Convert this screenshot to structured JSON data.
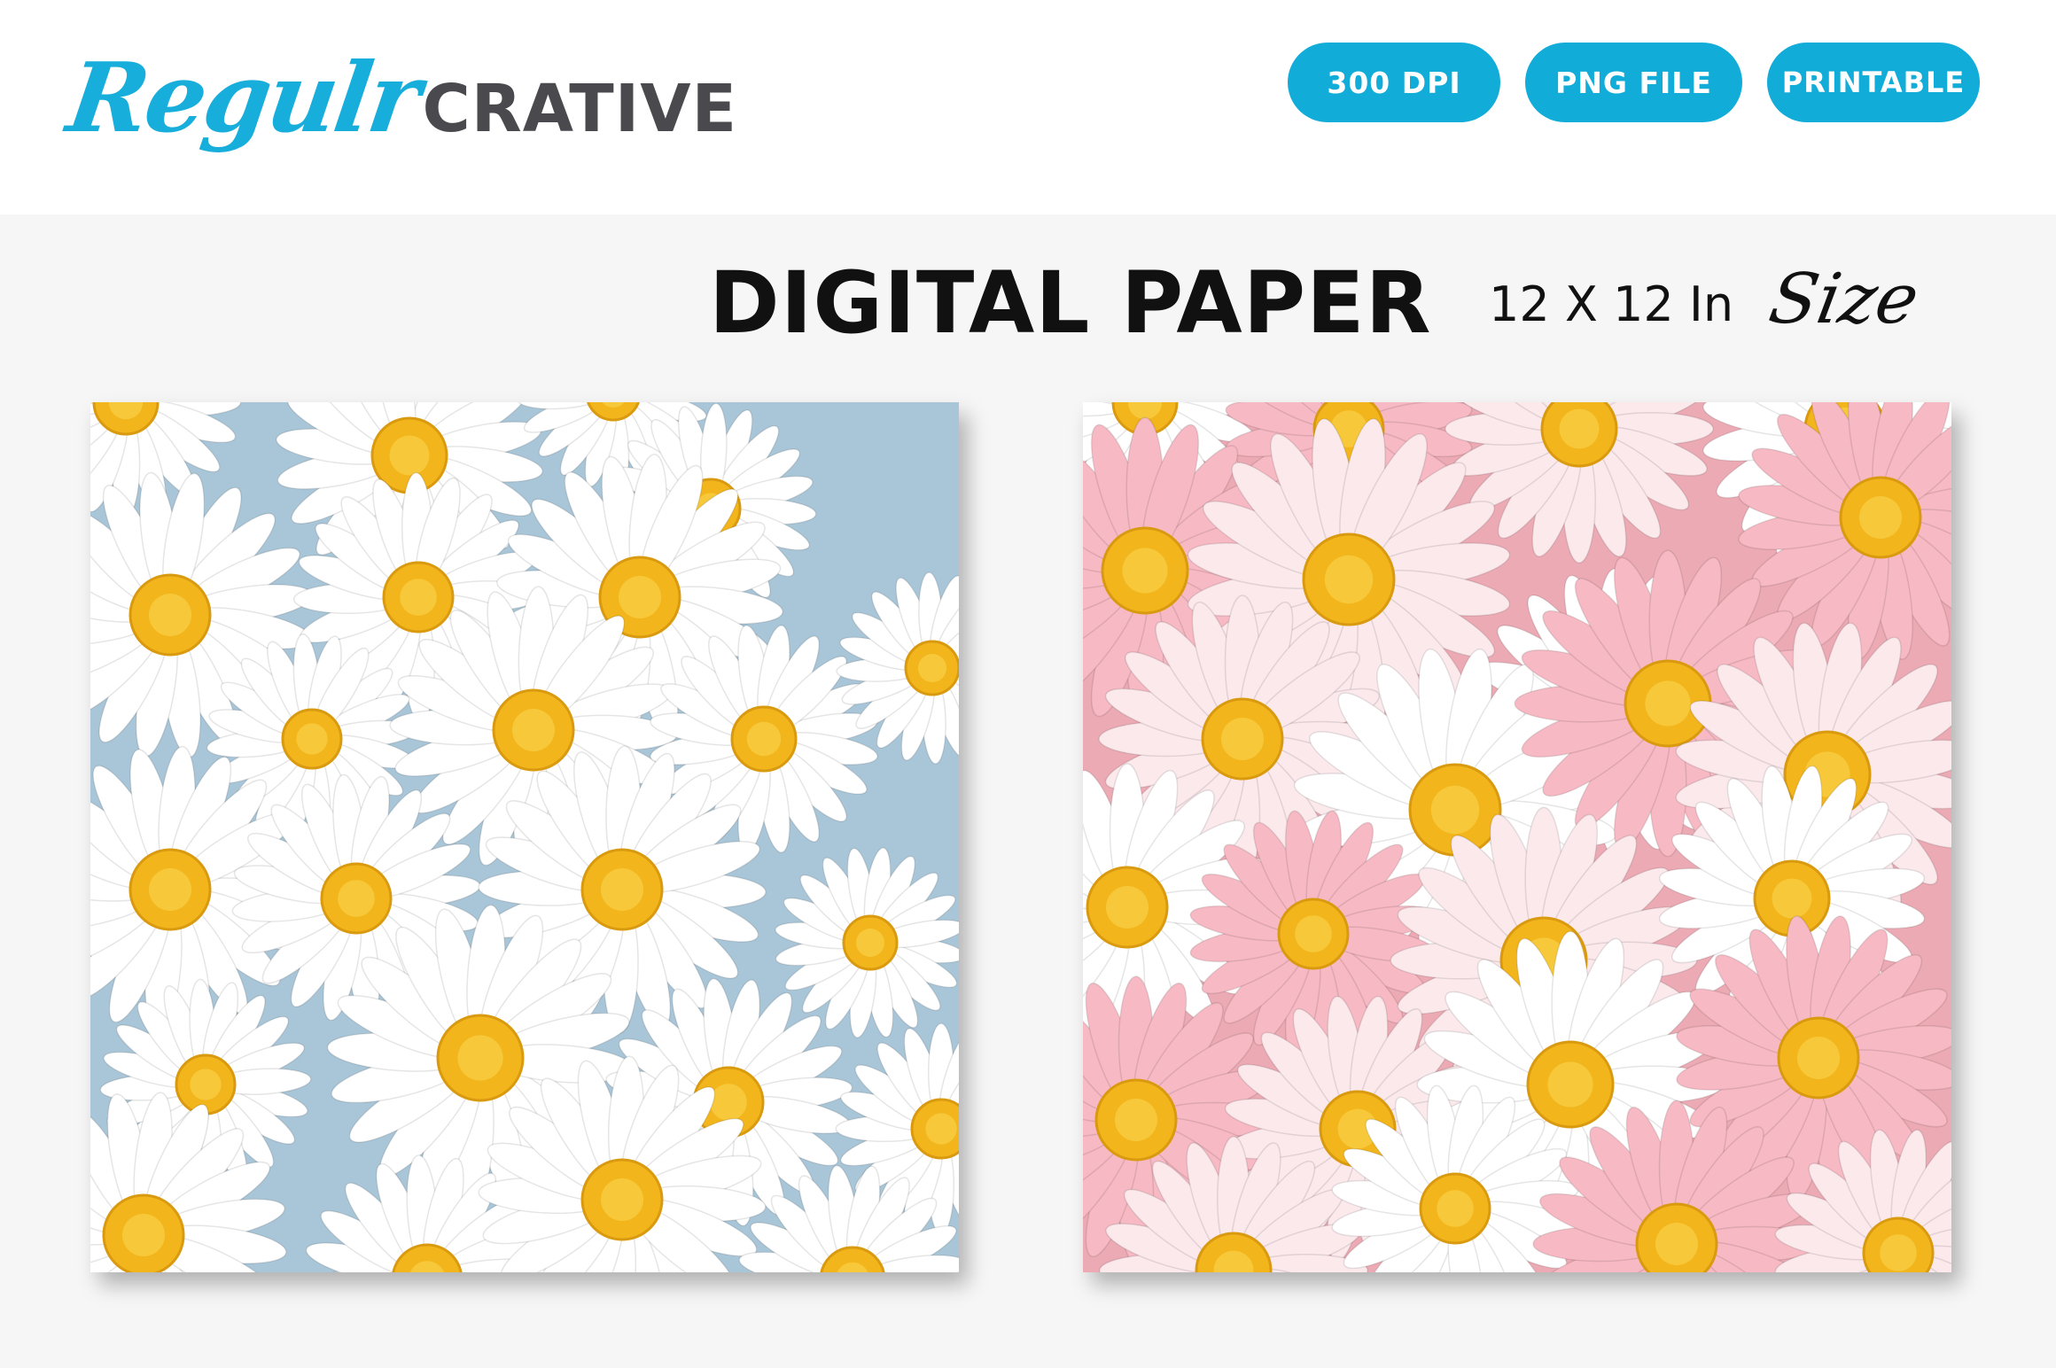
{
  "brand": {
    "script": "Regulr",
    "block": "CRATIVE"
  },
  "badges": [
    "300 DPI",
    "PNG FILE",
    "PRINTABLE"
  ],
  "title": "DIGITAL PAPER",
  "size": {
    "text": "12 X 12 In",
    "script": "Size"
  },
  "papers": [
    {
      "name": "blue-daisy-paper",
      "background": "#a9c6d8",
      "petal_color": "#ffffff",
      "center_color": "#f2b51c"
    },
    {
      "name": "pink-daisy-paper",
      "background": "#ecaab4",
      "petal_colors": [
        "#ffffff",
        "#f7b9c3",
        "#fbe9ec"
      ],
      "center_color": "#f2b51c"
    }
  ],
  "colors": {
    "accent": "#12acd9",
    "logo_script": "#18aedb",
    "logo_block": "#4a4a4e",
    "title": "#111111",
    "background": "#f6f6f6"
  }
}
